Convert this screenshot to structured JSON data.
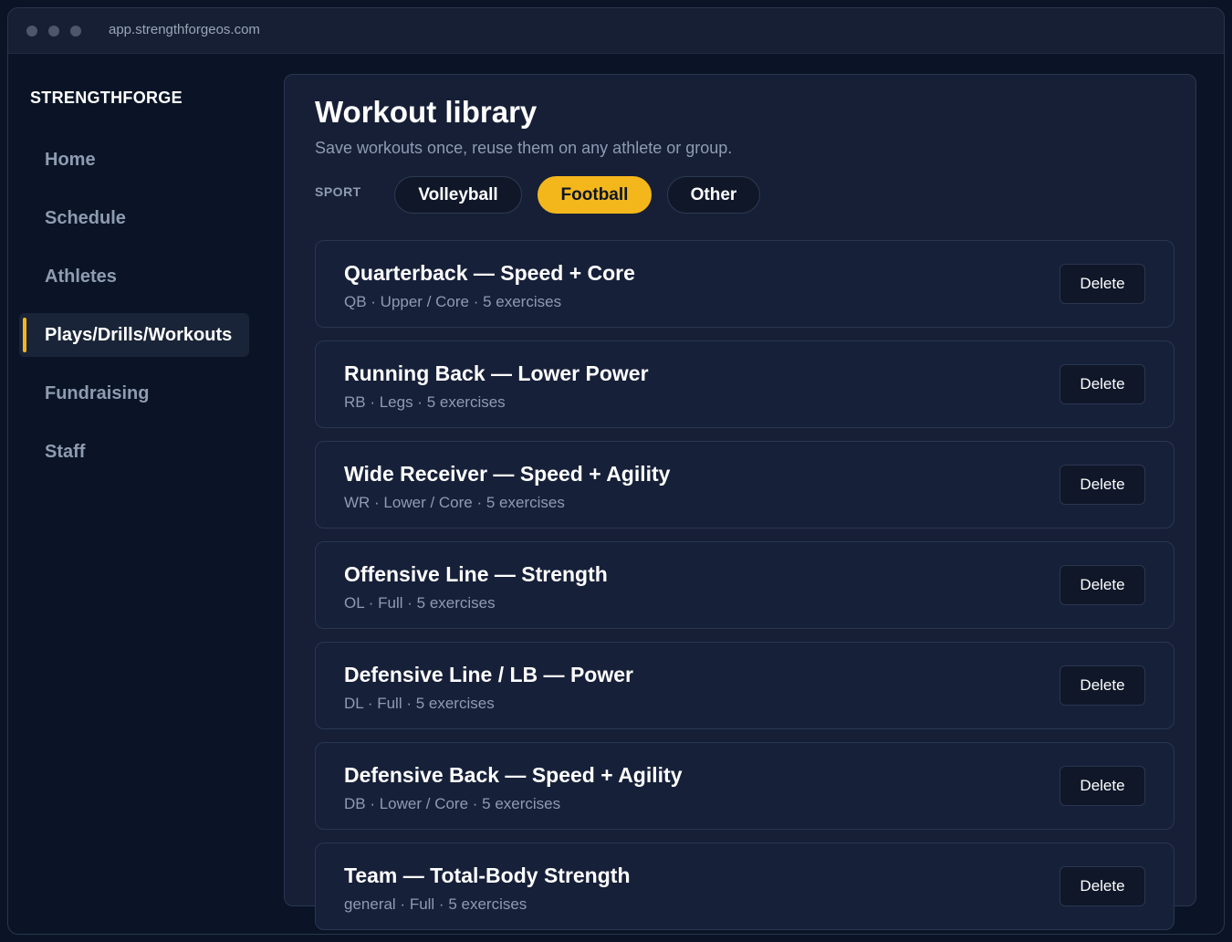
{
  "browser": {
    "url": "app.strengthforgeos.com"
  },
  "sidebar": {
    "brand": "STRENGTHFORGE",
    "items": [
      {
        "label": "Home",
        "active": false
      },
      {
        "label": "Schedule",
        "active": false
      },
      {
        "label": "Athletes",
        "active": false
      },
      {
        "label": "Plays/Drills/Workouts",
        "active": true
      },
      {
        "label": "Fundraising",
        "active": false
      },
      {
        "label": "Staff",
        "active": false
      }
    ]
  },
  "main": {
    "title": "Workout library",
    "subtitle": "Save workouts once, reuse them on any athlete or group.",
    "sport_label": "SPORT",
    "sports": [
      {
        "label": "Volleyball",
        "active": false
      },
      {
        "label": "Football",
        "active": true
      },
      {
        "label": "Other",
        "active": false
      }
    ],
    "delete_label": "Delete",
    "workouts": [
      {
        "title": "Quarterback — Speed + Core",
        "meta": "QB · Upper / Core · 5 exercises"
      },
      {
        "title": "Running Back — Lower Power",
        "meta": "RB · Legs · 5 exercises"
      },
      {
        "title": "Wide Receiver — Speed + Agility",
        "meta": "WR · Lower / Core · 5 exercises"
      },
      {
        "title": "Offensive Line — Strength",
        "meta": "OL · Full · 5 exercises"
      },
      {
        "title": "Defensive Line / LB — Power",
        "meta": "DL · Full · 5 exercises"
      },
      {
        "title": "Defensive Back — Speed + Agility",
        "meta": "DB · Lower / Core · 5 exercises"
      },
      {
        "title": "Team — Total-Body Strength",
        "meta": "general · Full · 5 exercises"
      }
    ]
  },
  "colors": {
    "accent": "#f4b71b",
    "background": "#0b1426",
    "panel": "#161f36"
  }
}
